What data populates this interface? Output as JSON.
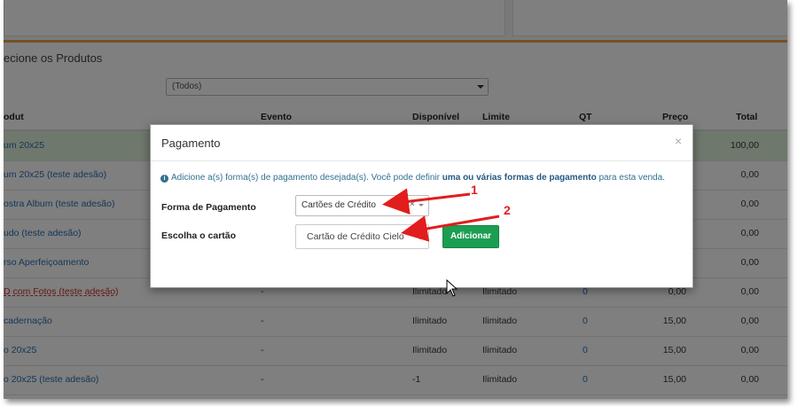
{
  "panel": {
    "title": "ecione os Produtos",
    "filter_value": "(Todos)"
  },
  "table": {
    "headers": {
      "produto": "odut",
      "evento": "Evento",
      "disponivel": "Disponível",
      "limite": "Limite",
      "qt": "QT",
      "preco": "Preço",
      "total": "Total"
    },
    "rows": [
      {
        "produto": "um 20x25",
        "evento": "",
        "disponivel": "",
        "limite": "",
        "qt": "",
        "preco": "",
        "total": "100,00"
      },
      {
        "produto": "um 20x25 (teste adesão)",
        "evento": "",
        "disponivel": "",
        "limite": "",
        "qt": "",
        "preco": "",
        "total": "0,00"
      },
      {
        "produto": "ostra Album (teste adesão)",
        "evento": "",
        "disponivel": "",
        "limite": "",
        "qt": "",
        "preco": "",
        "total": "0,00"
      },
      {
        "produto": "udo (teste adesão)",
        "evento": "",
        "disponivel": "",
        "limite": "",
        "qt": "",
        "preco": "",
        "total": "0,00"
      },
      {
        "produto": "rso Aperfeiçoamento",
        "evento": "",
        "disponivel": "",
        "limite": "",
        "qt": "",
        "preco": "",
        "total": "0,00"
      },
      {
        "produto": "D com Fotos (teste adesão)",
        "evento": "-",
        "disponivel": "Ilimitado",
        "limite": "Ilimitado",
        "qt": "0",
        "preco": "0,00",
        "total": "0,00"
      },
      {
        "produto": "cadernação",
        "evento": "-",
        "disponivel": "Ilimitado",
        "limite": "Ilimitado",
        "qt": "0",
        "preco": "15,00",
        "total": "0,00"
      },
      {
        "produto": "o 20x25",
        "evento": "-",
        "disponivel": "Ilimitado",
        "limite": "Ilimitado",
        "qt": "0",
        "preco": "15,00",
        "total": "0,00"
      },
      {
        "produto": "o 20x25 (teste adesão)",
        "evento": "-",
        "disponivel": "-1",
        "limite": "Ilimitado",
        "qt": "0",
        "preco": "15,00",
        "total": "0,00"
      }
    ]
  },
  "modal": {
    "title": "Pagamento",
    "close": "×",
    "info_pre": "Adicione a(s) forma(s) de pagamento desejada(s). Você pode definir ",
    "info_bold": "uma ou várias formas de pagamento",
    "info_post": " para esta venda.",
    "forma_label": "Forma de Pagamento",
    "forma_value": "Cartões de Crédito",
    "forma_clear": "×",
    "cartao_label": "Escolha o cartão",
    "cartao_value": "Cartão de Crédito Cielo",
    "add_button": "Adicionar"
  },
  "annotations": {
    "one": "1",
    "two": "2",
    "color": "#e21d1d"
  },
  "colors": {
    "accent_green": "#1b9e52",
    "highlight_row": "#dff0d8",
    "orange_bar": "#e8a34a",
    "link": "#2a6fb0"
  }
}
